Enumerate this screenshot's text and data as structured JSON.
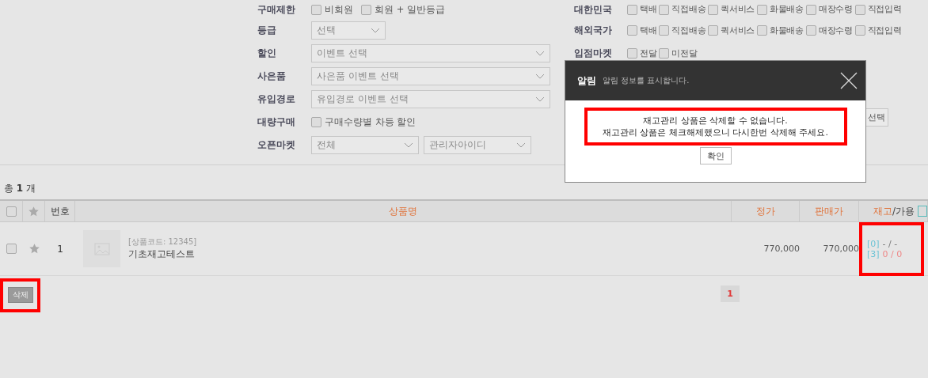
{
  "filters_left": [
    {
      "label": "구매제한",
      "kind": "checkboxes",
      "options": [
        {
          "label": "비회원",
          "checked": false
        },
        {
          "label": "회원 + 일반등급",
          "checked": false
        }
      ]
    },
    {
      "label": "등급",
      "kind": "selects",
      "selects": [
        {
          "value": "선택",
          "kind": "short"
        }
      ]
    },
    {
      "label": "할인",
      "kind": "selects",
      "selects": [
        {
          "value": "이벤트 선택",
          "kind": "wide"
        }
      ]
    },
    {
      "label": "사은품",
      "kind": "selects",
      "selects": [
        {
          "value": "사은품 이벤트 선택",
          "kind": "wide"
        }
      ]
    },
    {
      "label": "유입경로",
      "kind": "selects",
      "selects": [
        {
          "value": "유입경로 이벤트 선택",
          "kind": "wide"
        }
      ]
    },
    {
      "label": "대량구매",
      "kind": "checkboxes",
      "options": [
        {
          "label": "구매수량별 차등 할인",
          "checked": false
        }
      ]
    },
    {
      "label": "오픈마켓",
      "kind": "selects",
      "selects": [
        {
          "value": "전체",
          "kind": "half"
        },
        {
          "value": "관리자아이디",
          "kind": "half"
        }
      ]
    }
  ],
  "filters_right": [
    {
      "label": "대한민국",
      "kind": "checkboxes",
      "options": [
        {
          "label": "택배",
          "checked": false
        },
        {
          "label": "직접배송",
          "checked": false
        },
        {
          "label": "퀵서비스",
          "checked": false
        },
        {
          "label": "화물배송",
          "checked": false
        },
        {
          "label": "매장수령",
          "checked": false
        },
        {
          "label": "직접입력",
          "checked": false
        }
      ]
    },
    {
      "label": "해외국가",
      "kind": "checkboxes",
      "options": [
        {
          "label": "택배",
          "checked": false
        },
        {
          "label": "직접배송",
          "checked": false
        },
        {
          "label": "퀵서비스",
          "checked": false
        },
        {
          "label": "화물배송",
          "checked": false
        },
        {
          "label": "매장수령",
          "checked": false
        },
        {
          "label": "직접입력",
          "checked": false
        }
      ]
    },
    {
      "label": "입점마켓",
      "kind": "checkboxes",
      "options": [
        {
          "label": "전달",
          "checked": false
        },
        {
          "label": "미전달",
          "checked": false
        }
      ]
    }
  ],
  "side_button": "선택",
  "total": "총 **1** 개",
  "table": {
    "select_all": false,
    "columns": [
      "번호",
      "상품명",
      "정가",
      "판매가"
    ],
    "stock_header": {
      "primary": "재고",
      "secondary": "/가용"
    },
    "rows": [
      {
        "checked": false,
        "favorite": false,
        "number": "1",
        "code": "[상품코드: 12345]",
        "name": "기초재고테스트",
        "price": "770,000",
        "sale_price": "770,000",
        "stock": [
          {
            "tag": "[0]",
            "value": "- / -",
            "kind": "empty"
          },
          {
            "tag": "[3]",
            "value": "0 / 0",
            "kind": "count"
          }
        ]
      }
    ]
  },
  "delete_button": "삭제",
  "pages": [
    {
      "label": "1",
      "selected": true
    }
  ],
  "dialog": {
    "title": "알림",
    "subtitle": "알림 정보를 표시합니다.",
    "message": [
      "재고관리 상품은 삭제할 수 없습니다.",
      "재고관리 상품은 체크해제했으니 다시한번 삭제해 주세요."
    ],
    "button": "확인"
  }
}
